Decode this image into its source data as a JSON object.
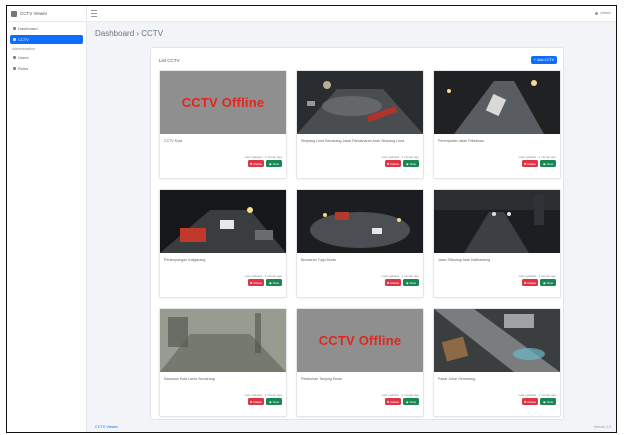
{
  "app": {
    "name": "CCTV Viewer"
  },
  "sidebar": {
    "items": [
      {
        "label": "Dashboard",
        "active": false
      },
      {
        "label": "CCTV",
        "active": true
      }
    ],
    "section": "Administration",
    "sub_items": [
      {
        "label": "Users"
      },
      {
        "label": "Roles"
      }
    ]
  },
  "header": {
    "user": "Admin"
  },
  "breadcrumb": "Dashboard › CCTV",
  "card": {
    "title": "List CCTV",
    "add_label": "Add CCTV"
  },
  "offline_label": "CCTV Offline",
  "cameras": [
    {
      "name": "CCTV Kota",
      "meta": "Last updated · 1 minute ago",
      "offline": true,
      "scene": "offline"
    },
    {
      "name": "Simpang Lima Semarang Jalan Pandanaran Arah Simpang Lima",
      "meta": "Last updated · 1 minute ago",
      "offline": false,
      "scene": "road"
    },
    {
      "name": "Perempatan Jalan Pahlawan",
      "meta": "Last updated · 1 minute ago",
      "offline": false,
      "scene": "junction"
    },
    {
      "name": "Persimpangan Kaligarang",
      "meta": "Last updated · 1 minute ago",
      "offline": false,
      "scene": "traffic"
    },
    {
      "name": "Bundaran Tugu Muda",
      "meta": "Last updated · 1 minute ago",
      "offline": false,
      "scene": "roundabout"
    },
    {
      "name": "Jalan Siliwangi Arah Kalibanteng",
      "meta": "Last updated · 1 minute ago",
      "offline": false,
      "scene": "dark"
    },
    {
      "name": "Kawasan Kota Lama Semarang",
      "meta": "Last updated · 1 minute ago",
      "offline": false,
      "scene": "fog"
    },
    {
      "name": "Pelabuhan Tanjung Emas",
      "meta": "Last updated · 1 minute ago",
      "offline": true,
      "scene": "offline"
    },
    {
      "name": "Pasar Johar Semarang",
      "meta": "Last updated · 1 minute ago",
      "offline": false,
      "scene": "aerial"
    }
  ],
  "buttons": {
    "delete": "Delete",
    "view": "View"
  },
  "footer": {
    "left": "CCTV Viewer",
    "right": "Version 1.0"
  },
  "colors": {
    "primary": "#0d6efd",
    "danger": "#dc3545",
    "success": "#198754",
    "offline_bg": "#8f8f8f",
    "offline_text": "#e0261e"
  }
}
